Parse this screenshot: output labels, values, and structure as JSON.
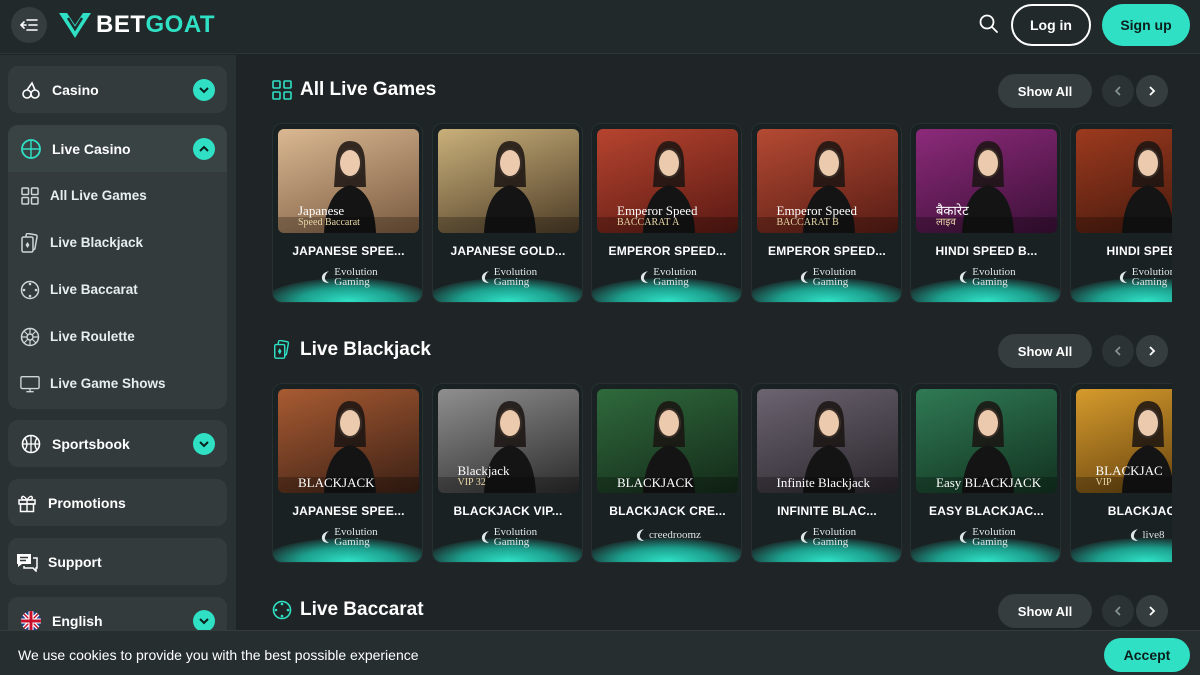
{
  "brand": {
    "bet": "BET",
    "goat": "GOAT"
  },
  "header": {
    "login_label": "Log in",
    "signup_label": "Sign up"
  },
  "sidebar": {
    "casino": "Casino",
    "live_casino": "Live Casino",
    "sub_items": [
      "All Live Games",
      "Live Blackjack",
      "Live Baccarat",
      "Live Roulette",
      "Live Game Shows"
    ],
    "sportsbook": "Sportsbook",
    "promotions": "Promotions",
    "support": "Support",
    "language": "English"
  },
  "sections": [
    {
      "title": "All Live Games",
      "show_all": "Show All",
      "cards": [
        {
          "title": "JAPANESE SPEE...",
          "provider": [
            "Evolution",
            "Gaming"
          ],
          "overlay": "Japanese",
          "overlay_sub": "Speed Baccarat",
          "bg": [
            "#d9b892",
            "#7a5a3f"
          ]
        },
        {
          "title": "JAPANESE GOLD...",
          "provider": [
            "Evolution",
            "Gaming"
          ],
          "overlay": "",
          "overlay_sub": "",
          "bg": [
            "#c9b07a",
            "#4e3d27"
          ]
        },
        {
          "title": "EMPEROR SPEED...",
          "provider": [
            "Evolution",
            "Gaming"
          ],
          "overlay": "Emperor Speed",
          "overlay_sub": "BACCARAT A",
          "bg": [
            "#b6442f",
            "#5a1913"
          ]
        },
        {
          "title": "EMPEROR SPEED...",
          "provider": [
            "Evolution",
            "Gaming"
          ],
          "overlay": "Emperor Speed",
          "overlay_sub": "BACCARAT B",
          "bg": [
            "#b44a33",
            "#571c14"
          ]
        },
        {
          "title": "HINDI SPEED B...",
          "provider": [
            "Evolution",
            "Gaming"
          ],
          "overlay": "बैकारेट",
          "overlay_sub": "लाइव",
          "bg": [
            "#8c2a7a",
            "#3b1037"
          ]
        },
        {
          "title": "HINDI SPEED",
          "provider": [
            "Evolution",
            "Gaming"
          ],
          "overlay": "",
          "overlay_sub": "",
          "bg": [
            "#9c3a1e",
            "#3f170c"
          ]
        }
      ]
    },
    {
      "title": "Live Blackjack",
      "show_all": "Show All",
      "cards": [
        {
          "title": "JAPANESE SPEE...",
          "provider": [
            "Evolution",
            "Gaming"
          ],
          "overlay": "BLACKJACK",
          "overlay_sub": "",
          "bg": [
            "#a85b32",
            "#3b2015"
          ]
        },
        {
          "title": "BLACKJACK VIP...",
          "provider": [
            "Evolution",
            "Gaming"
          ],
          "overlay": "Blackjack",
          "overlay_sub": "VIP 32",
          "bg": [
            "#8f8f8f",
            "#2b2b2b"
          ]
        },
        {
          "title": "BLACKJACK CRE...",
          "provider": [
            "creedroomz"
          ],
          "overlay": "BLACKJACK",
          "overlay_sub": "",
          "bg": [
            "#2f6a3c",
            "#142a19"
          ]
        },
        {
          "title": "INFINITE BLAC...",
          "provider": [
            "Evolution",
            "Gaming"
          ],
          "overlay": "Infinite Blackjack",
          "overlay_sub": "",
          "bg": [
            "#6c6470",
            "#2a262d"
          ]
        },
        {
          "title": "EASY BLACKJAC...",
          "provider": [
            "Evolution",
            "Gaming"
          ],
          "overlay": "Easy BLACKJACK",
          "overlay_sub": "",
          "bg": [
            "#2f7a55",
            "#12321f"
          ]
        },
        {
          "title": "BLACKJACK",
          "provider": [
            "live8"
          ],
          "overlay": "BLACKJAC",
          "overlay_sub": "VIP",
          "bg": [
            "#d69b2c",
            "#5a3a0c"
          ]
        }
      ]
    },
    {
      "title": "Live Baccarat",
      "show_all": "Show All",
      "cards": []
    }
  ],
  "cookie": {
    "text": "We use cookies to provide you with the best possible experience",
    "accept_label": "Accept"
  },
  "colors": {
    "accent": "#2fe0c5",
    "bg": "#1f2526",
    "sidebar": "#293132"
  }
}
